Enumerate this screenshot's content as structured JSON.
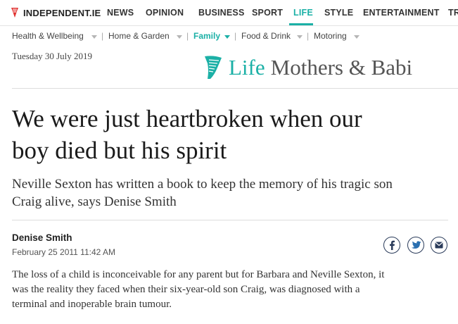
{
  "topnav": {
    "brand": "INDEPENDENT.IE",
    "items": [
      "NEWS",
      "OPINION",
      "BUSINESS",
      "SPORT",
      "LIFE",
      "STYLE",
      "ENTERTAINMENT",
      "TR"
    ],
    "active": "LIFE",
    "accent_color": "#1bb0a6"
  },
  "subnav": {
    "items": [
      "Health & Wellbeing",
      "Home & Garden",
      "Family",
      "Food & Drink",
      "Motoring"
    ],
    "active": "Family"
  },
  "date": "Tuesday 30 July 2019",
  "section": {
    "life": "Life",
    "name": "Mothers & Babi",
    "icon": "harp-icon"
  },
  "article": {
    "headline_line1": "We were just heartbroken when our",
    "headline_line2": "boy died but his spirit",
    "standfirst_line1": "Neville Sexton has written a book to keep the memory of his tragic son",
    "standfirst_line2": "Craig alive, says Denise Smith",
    "author": "Denise Smith",
    "published": "February 25 2011 11:42 AM",
    "share_icons": [
      "facebook-icon",
      "twitter-icon",
      "email-icon"
    ],
    "body_line1": "The loss of a child is inconceivable for any parent but for Barbara and Neville Sexton, it",
    "body_line2": "was the reality they faced when their six-year-old son Craig, was diagnosed with a",
    "body_line3": "terminal and inoperable brain tumour."
  }
}
